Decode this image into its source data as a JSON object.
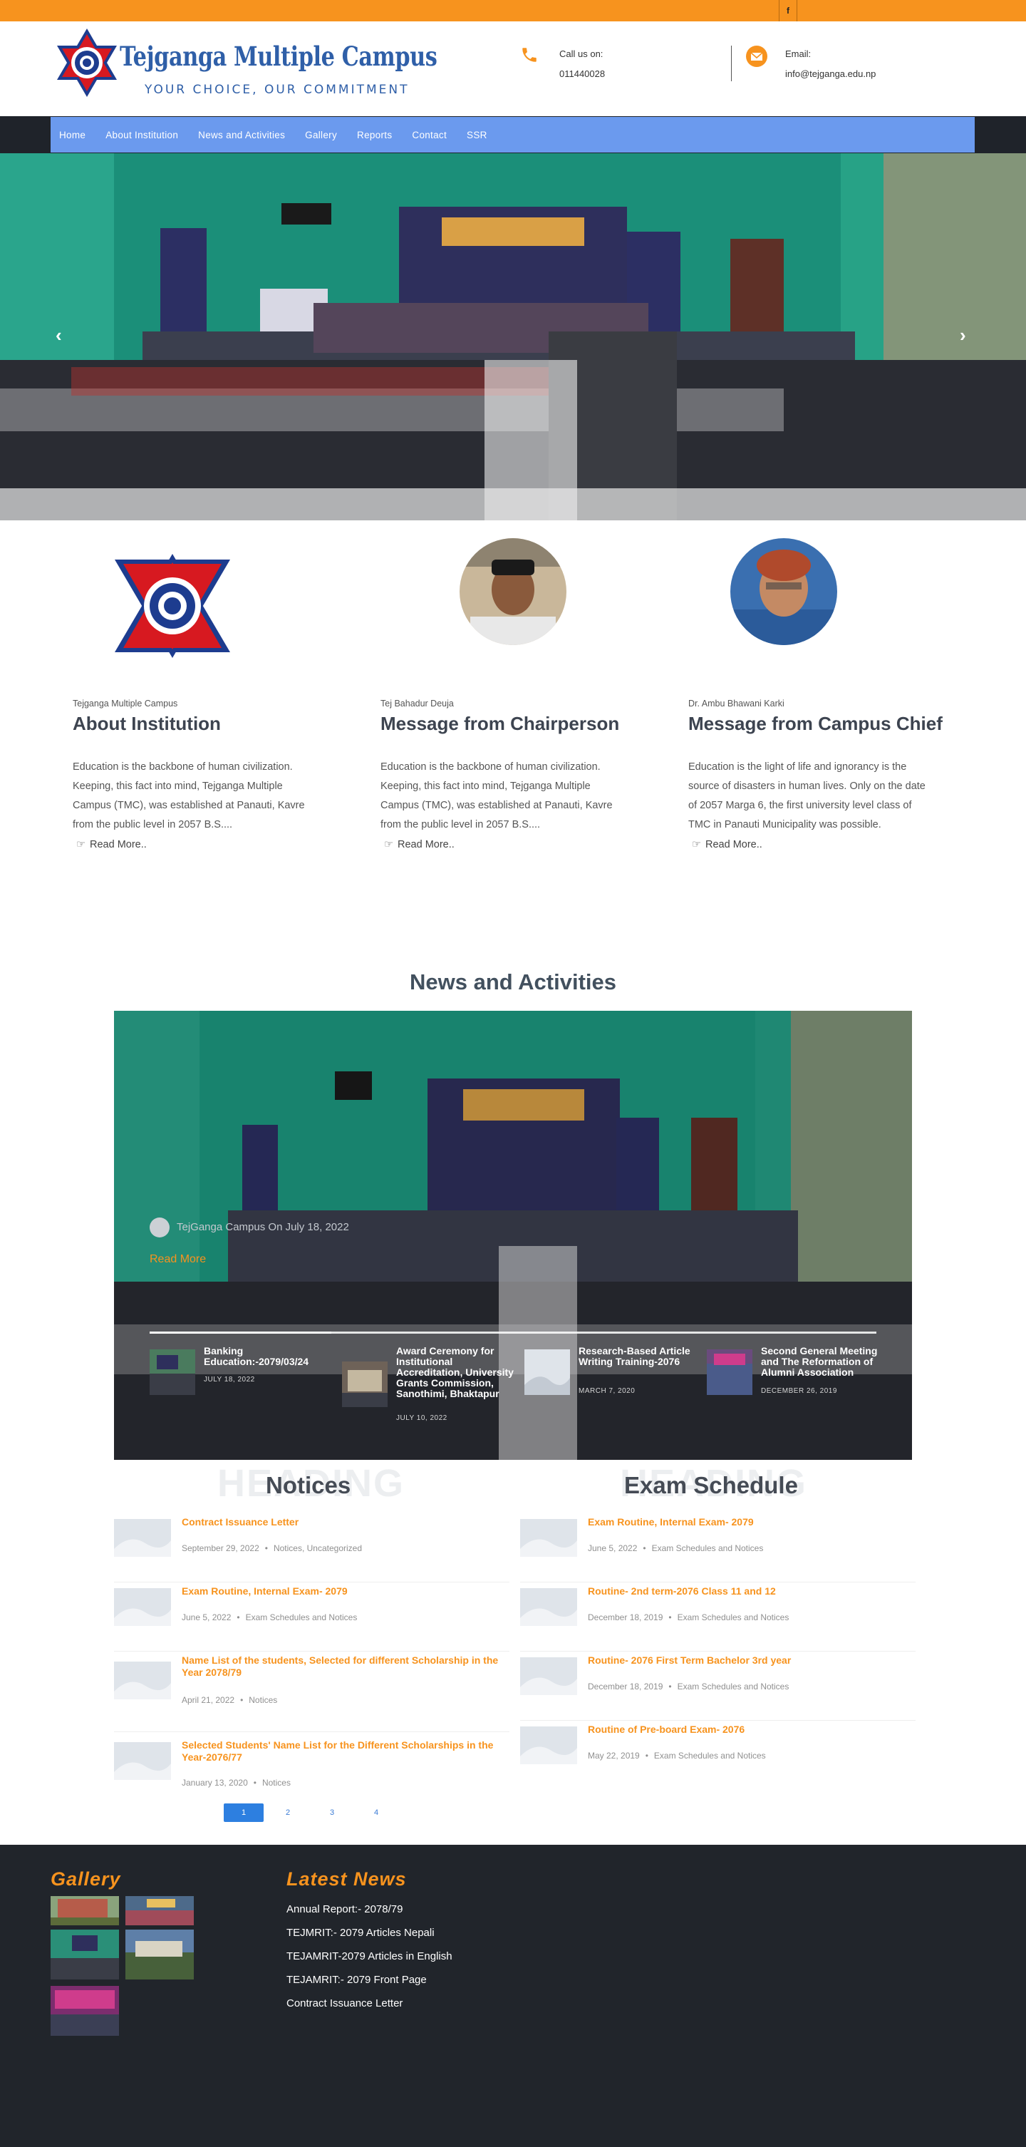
{
  "topbar": {
    "facebook_icon": "facebook-icon",
    "facebook_glyph": "f"
  },
  "header": {
    "site_title": "Tejganga Multiple Campus",
    "tagline": "YOUR CHOICE, OUR COMMITMENT",
    "logo_icon": "college-emblem-icon",
    "phone": {
      "icon": "phone-icon",
      "label": "Call us on:",
      "value": "011440028"
    },
    "email": {
      "icon": "envelope-icon",
      "label": "Email:",
      "value": "info@tejganga.edu.np"
    }
  },
  "nav": {
    "items": [
      {
        "label": "Home"
      },
      {
        "label": "About Institution"
      },
      {
        "label": "News and Activities"
      },
      {
        "label": "Gallery"
      },
      {
        "label": "Reports"
      },
      {
        "label": "Contact"
      },
      {
        "label": "SSR"
      }
    ]
  },
  "hero": {
    "prev_icon": "chevron-left-icon",
    "next_icon": "chevron-right-icon",
    "prev_glyph": "‹",
    "next_glyph": "›"
  },
  "intro": [
    {
      "subtitle": "Tejganga Multiple Campus",
      "heading": "About Institution",
      "text": "Education is the backbone of human civilization. Keeping, this fact into mind, Tejganga Multiple Campus (TMC), was established at Panauti, Kavre from the public level in 2057 B.S....",
      "more": "Read More..",
      "image": "institution-logo"
    },
    {
      "subtitle": "Tej Bahadur Deuja",
      "heading": "Message from Chairperson",
      "text": "Education is the backbone of human civilization. Keeping, this fact into mind, Tejganga Multiple Campus (TMC), was established at Panauti, Kavre from the public level in 2057 B.S....",
      "more": "Read More..",
      "image": "chairperson-photo"
    },
    {
      "subtitle": "Dr. Ambu Bhawani Karki",
      "heading": "Message from Campus Chief",
      "text": "Education is the light of life and ignorancy is the source of disasters in human lives. Only on the date of 2057 Marga 6, the first university level class of TMC in Panauti Municipality was possible.",
      "more": "Read More..",
      "image": "campus-chief-photo"
    }
  ],
  "news": {
    "title": "News and Activities",
    "featured_meta": "TejGanga Campus On July 18, 2022",
    "read_more": "Read More",
    "progress_fraction": 0.25,
    "items": [
      {
        "title": "Banking Education:-2079/03/24",
        "date": "JULY 18, 2022"
      },
      {
        "title": "Award Ceremony for Institutional Accreditation, University Grants Commission, Sanothimi, Bhaktapur",
        "date": "JULY 10, 2022"
      },
      {
        "title": "Research-Based Article Writing Training-2076",
        "date": "MARCH 7, 2020"
      },
      {
        "title": "Second General Meeting and The Reformation of Alumni Association",
        "date": "DECEMBER 26, 2019"
      }
    ]
  },
  "notices": {
    "watermark": "HEADING",
    "title": "Notices",
    "items": [
      {
        "title": "Contract Issuance Letter",
        "date": "September 29, 2022",
        "cats": "Notices, Uncategorized"
      },
      {
        "title": "Exam Routine, Internal Exam- 2079",
        "date": "June 5, 2022",
        "cats": "Exam Schedules and Notices"
      },
      {
        "title": "Name List of the students, Selected for different Scholarship in the Year 2078/79",
        "date": "April 21, 2022",
        "cats": "Notices"
      },
      {
        "title": "Selected Students' Name List for the Different Scholarships in the Year-2076/77",
        "date": "January 13, 2020",
        "cats": "Notices"
      }
    ],
    "pages": [
      "1",
      "2",
      "3",
      "4"
    ],
    "active_page": "1"
  },
  "exams": {
    "watermark": "HEADING",
    "title": "Exam Schedule",
    "items": [
      {
        "title": "Exam Routine, Internal Exam- 2079",
        "date": "June 5, 2022",
        "cats": "Exam Schedules and Notices"
      },
      {
        "title": "Routine- 2nd term-2076 Class 11 and 12",
        "date": "December 18, 2019",
        "cats": "Exam Schedules and Notices"
      },
      {
        "title": "Routine- 2076 First Term Bachelor 3rd year",
        "date": "December 18, 2019",
        "cats": "Exam Schedules and Notices"
      },
      {
        "title": "Routine of Pre-board Exam- 2076",
        "date": "May 22, 2019",
        "cats": "Exam Schedules and Notices"
      }
    ]
  },
  "footer": {
    "gallery_title": "Gallery",
    "latest_title": "Latest News",
    "latest": [
      "Annual Report:- 2078/79",
      "TEJMRIT:- 2079 Articles Nepali",
      "TEJAMRIT-2079 Articles in English",
      "TEJAMRIT:- 2079 Front Page",
      "Contract Issuance Letter"
    ]
  },
  "colors": {
    "accent": "#f7931e",
    "nav": "#6b9aee",
    "footer": "#21252b",
    "brand_blue": "#2f5fa8"
  }
}
